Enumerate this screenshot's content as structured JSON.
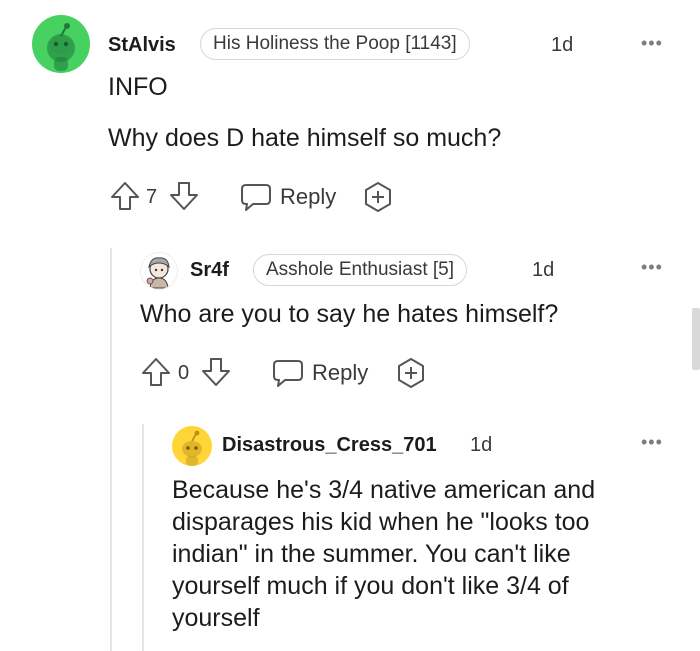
{
  "comments": [
    {
      "username": "StAlvis",
      "flair": "His Holiness the Poop [1143]",
      "age": "1d",
      "lines": [
        "INFO",
        "Why does D hate himself so much?"
      ],
      "votes": "7",
      "reply_label": "Reply",
      "avatar_color": "#46d160"
    },
    {
      "username": "Sr4f",
      "flair": "Asshole Enthusiast [5]",
      "age": "1d",
      "lines": [
        "Who are you to say he hates himself?"
      ],
      "votes": "0",
      "reply_label": "Reply",
      "avatar_color": "#ffffff"
    },
    {
      "username": "Disastrous_Cress_701",
      "age": "1d",
      "lines": [
        "Because he's 3/4 native american and",
        "disparages his kid when he \"looks too",
        "indian\" in the summer. You can't like",
        "yourself much if you don't like 3/4 of",
        "yourself"
      ],
      "avatar_color": "#ffd635"
    }
  ],
  "more_options": "•••",
  "thread_line_color": "#e6e6e6"
}
